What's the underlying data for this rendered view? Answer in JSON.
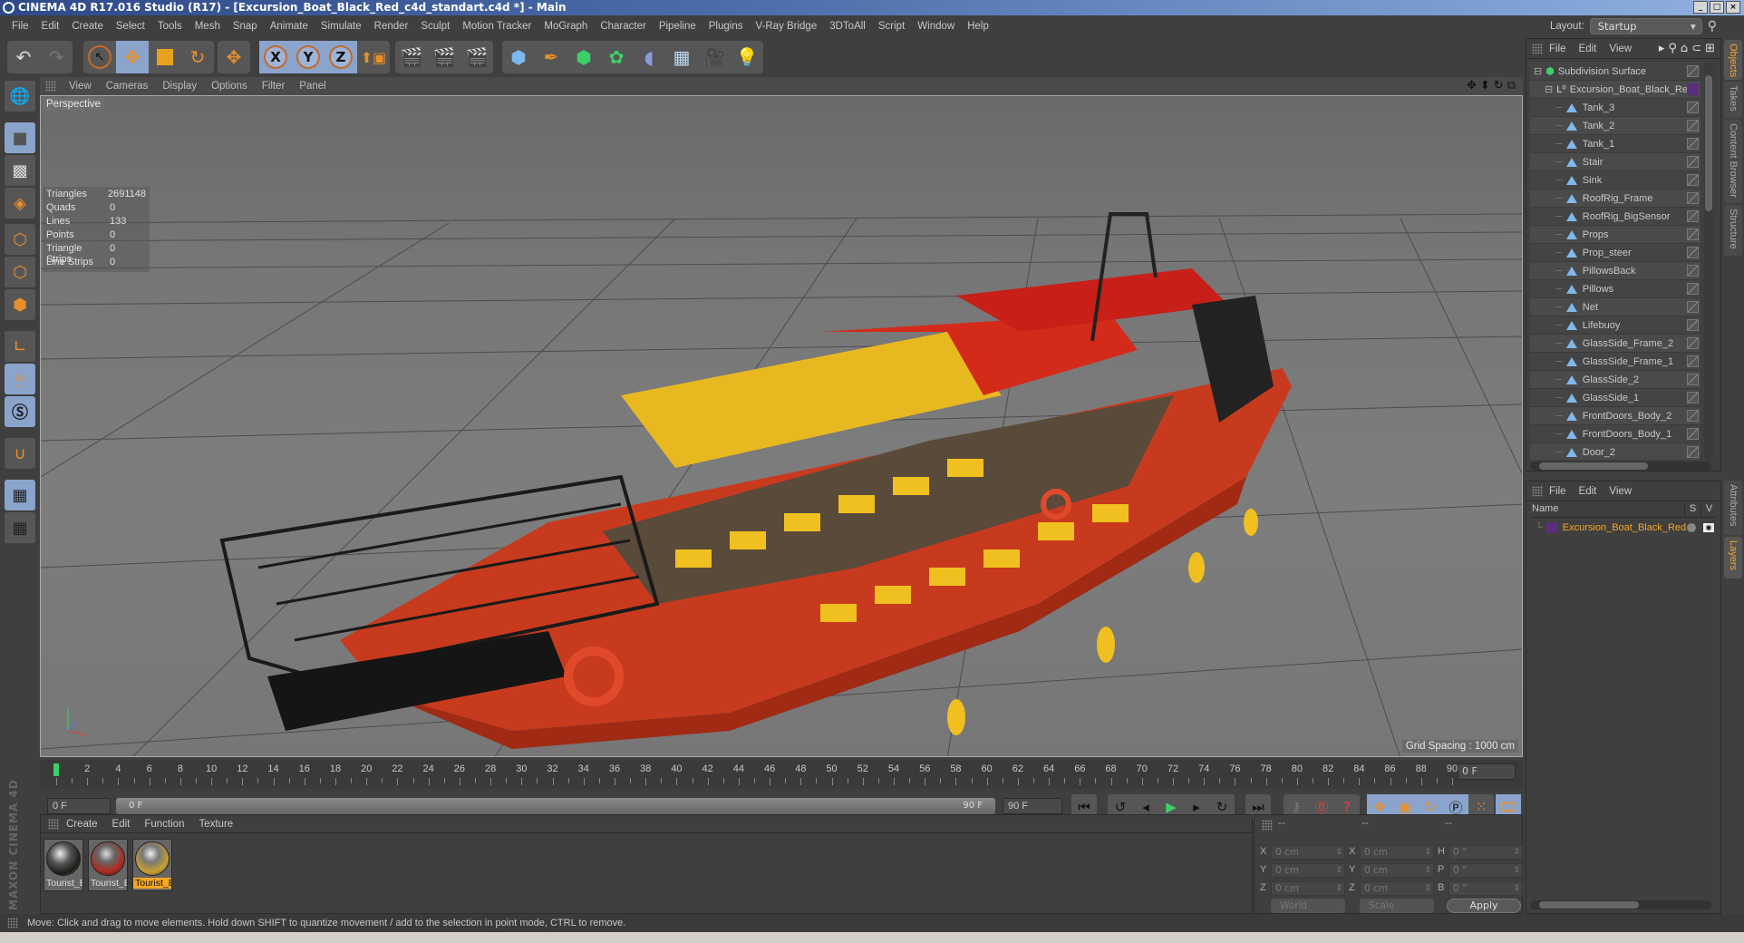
{
  "window": {
    "title": "CINEMA 4D R17.016 Studio (R17) - [Excursion_Boat_Black_Red_c4d_standart.c4d *] - Main",
    "controls": [
      "_",
      "□",
      "×"
    ]
  },
  "menubar": {
    "items": [
      "File",
      "Edit",
      "Create",
      "Select",
      "Tools",
      "Mesh",
      "Snap",
      "Animate",
      "Simulate",
      "Render",
      "Sculpt",
      "Motion Tracker",
      "MoGraph",
      "Character",
      "Pipeline",
      "Plugins",
      "V-Ray Bridge",
      "3DToAll",
      "Script",
      "Window",
      "Help"
    ],
    "layout_label": "Layout:",
    "layout_value": "Startup"
  },
  "toolbar": {
    "undo": "↶",
    "redo": "↷",
    "axes": [
      "X",
      "Y",
      "Z"
    ]
  },
  "viewport": {
    "menu": [
      "View",
      "Cameras",
      "Display",
      "Options",
      "Filter",
      "Panel"
    ],
    "camera_label": "Perspective",
    "stats": [
      {
        "k": "Triangles",
        "v": "2691148"
      },
      {
        "k": "Quads",
        "v": "0"
      },
      {
        "k": "Lines",
        "v": "133"
      },
      {
        "k": "Points",
        "v": "0"
      },
      {
        "k": "Triangle Strips",
        "v": "0"
      },
      {
        "k": "Line Strips",
        "v": "0"
      }
    ],
    "grid_spacing": "Grid Spacing : 1000 cm"
  },
  "timeline": {
    "ticks": [
      "0",
      "2",
      "4",
      "6",
      "8",
      "10",
      "12",
      "14",
      "16",
      "18",
      "20",
      "22",
      "24",
      "26",
      "28",
      "30",
      "32",
      "34",
      "36",
      "38",
      "40",
      "42",
      "44",
      "46",
      "48",
      "50",
      "52",
      "54",
      "56",
      "58",
      "60",
      "62",
      "64",
      "66",
      "68",
      "70",
      "72",
      "74",
      "76",
      "78",
      "80",
      "82",
      "84",
      "86",
      "88",
      "90"
    ],
    "current_frame": "0 F",
    "start_field": "0 F",
    "range_start": "0 F",
    "range_end": "90 F",
    "end_field": "90 F"
  },
  "material_manager": {
    "menu": [
      "Create",
      "Edit",
      "Function",
      "Texture"
    ],
    "materials": [
      {
        "label": "Tourist_B",
        "selected": false
      },
      {
        "label": "Tourist_B",
        "selected": false
      },
      {
        "label": "Tourist_B",
        "selected": true
      }
    ]
  },
  "coordinates": {
    "headers": [
      "--",
      "--",
      "--"
    ],
    "rows": [
      {
        "l1": "X",
        "v1": "0 cm",
        "l2": "X",
        "v2": "0 cm",
        "l3": "H",
        "v3": "0 °"
      },
      {
        "l1": "Y",
        "v1": "0 cm",
        "l2": "Y",
        "v2": "0 cm",
        "l3": "P",
        "v3": "0 °"
      },
      {
        "l1": "Z",
        "v1": "0 cm",
        "l2": "Z",
        "v2": "0 cm",
        "l3": "B",
        "v3": "0 °"
      }
    ],
    "mode_dropdown": "World",
    "scale_dropdown": "Scale",
    "apply_label": "Apply"
  },
  "object_manager": {
    "menu": [
      "File",
      "Edit",
      "View"
    ],
    "root": "Subdivision Surface",
    "group": "Excursion_Boat_Black_Red",
    "children": [
      "Tank_3",
      "Tank_2",
      "Tank_1",
      "Stair",
      "Sink",
      "RoofRig_Frame",
      "RoofRig_BigSensor",
      "Props",
      "Prop_steer",
      "PillowsBack",
      "Pillows",
      "Net",
      "Lifebuoy",
      "GlassSide_Frame_2",
      "GlassSide_Frame_1",
      "GlassSide_2",
      "GlassSide_1",
      "FrontDoors_Body_2",
      "FrontDoors_Body_1",
      "Door_2"
    ]
  },
  "layer_manager": {
    "menu": [
      "File",
      "Edit",
      "View"
    ],
    "columns": {
      "name": "Name",
      "s": "S",
      "v": "V"
    },
    "layers": [
      {
        "name": "Excursion_Boat_Black_Red",
        "color": "#5a2e7a"
      }
    ]
  },
  "side_tabs": {
    "top": [
      "Objects",
      "Takes",
      "Content Browser",
      "Structure"
    ],
    "bottom": [
      "Attributes",
      "Layers"
    ]
  },
  "status_bar": {
    "message": "Move: Click and drag to move elements. Hold down SHIFT to quantize movement / add to the selection in point mode, CTRL to remove."
  },
  "branding": {
    "text": "MAXON CINEMA 4D"
  },
  "colors": {
    "accent": "#f5a623",
    "active_button": "#8aa4cc",
    "playhead": "#3cd06a"
  }
}
